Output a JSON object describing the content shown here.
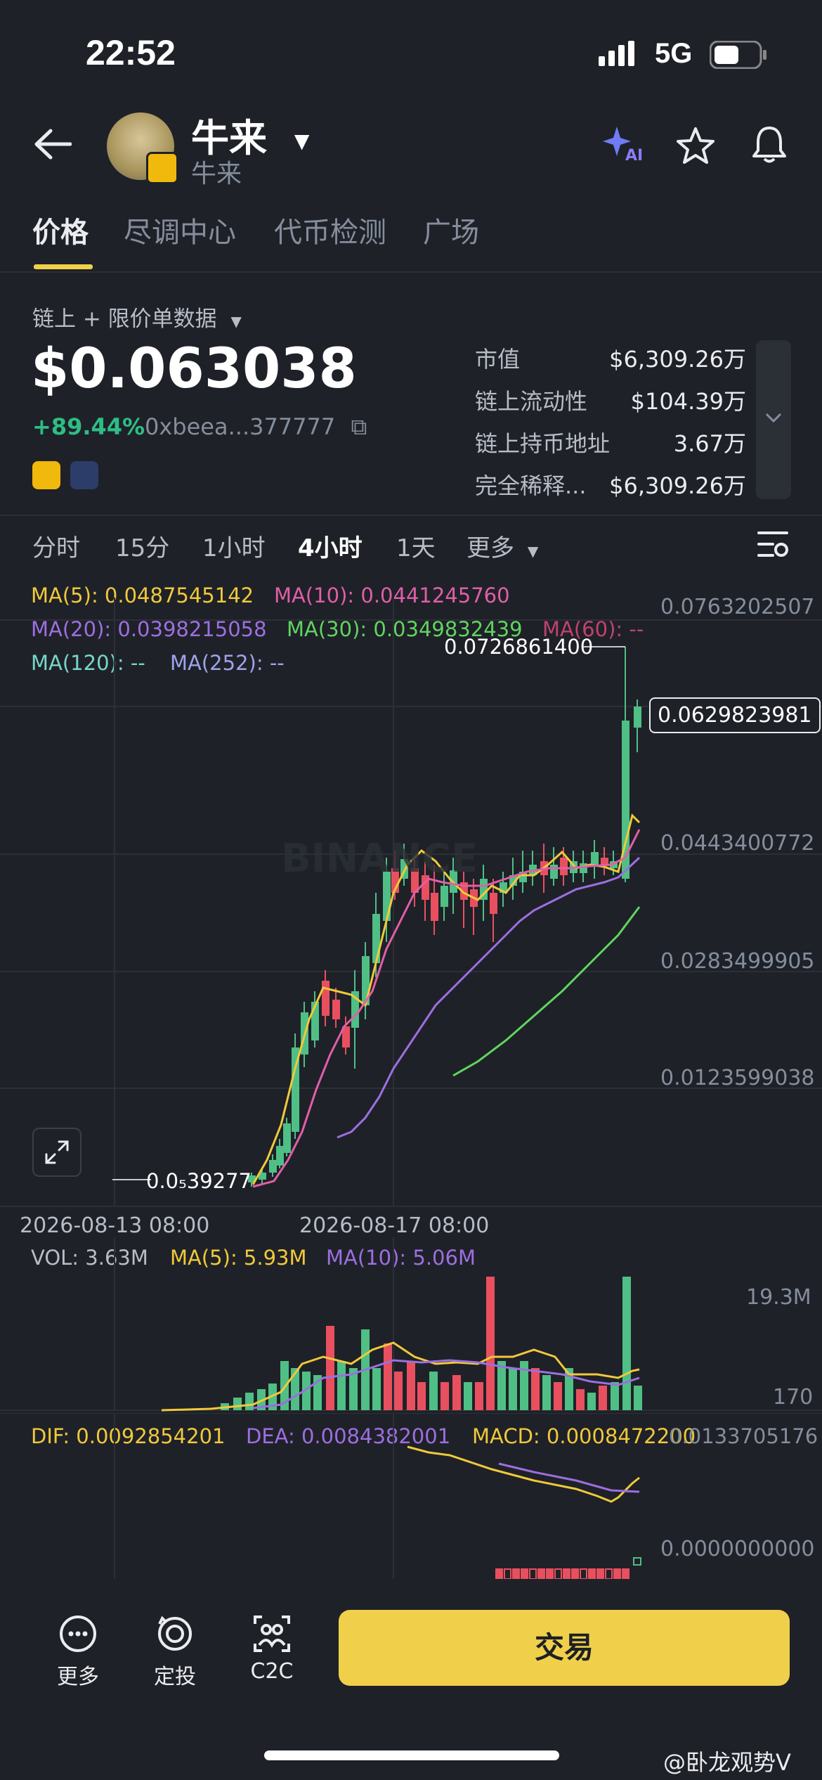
{
  "status_bar": {
    "time": "22:52",
    "network": "5G"
  },
  "header": {
    "title": "牛来",
    "subtitle": "牛来",
    "ai_badge": "AI"
  },
  "tabs": [
    "价格",
    "尽调中心",
    "代币检测",
    "广场"
  ],
  "data_source": "链上 + 限价单数据",
  "price": {
    "value": "$0.063038",
    "change": "+89.44%",
    "address": "0xbeea...377777"
  },
  "stats": [
    {
      "label": "市值",
      "value": "$6,309.26万"
    },
    {
      "label": "链上流动性",
      "value": "$104.39万"
    },
    {
      "label": "链上持币地址",
      "value": "3.67万"
    },
    {
      "label": "完全稀释...",
      "value": "$6,309.26万"
    }
  ],
  "timeframes": [
    "分时",
    "15分",
    "1小时",
    "4小时",
    "1天",
    "更多"
  ],
  "ma_lines": {
    "ma5": "MA(5): 0.0487545142",
    "ma10": "MA(10): 0.0441245760",
    "ma20": "MA(20): 0.0398215058",
    "ma30": "MA(30): 0.0349832439",
    "ma60": "MA(60): --",
    "ma120": "MA(120): --",
    "ma252": "MA(252): --"
  },
  "price_axis": [
    "0.0763202507",
    "0.0443400772",
    "0.0283499905",
    "0.0123599038"
  ],
  "current_price_tag": "0.0629823981",
  "high_label": "0.0726861400",
  "low_label": "0.0₅39277",
  "watermark": "BINANCE",
  "date_labels": [
    "2026-08-13 08:00",
    "2026-08-17 08:00"
  ],
  "volume": {
    "vol": "VOL: 3.63M",
    "ma5": "MA(5): 5.93M",
    "ma10": "MA(10): 5.06M",
    "axis_top": "19.3M",
    "axis_bottom": "170"
  },
  "macd": {
    "dif": "DIF: 0.0092854201",
    "dea": "DEA: 0.0084382001",
    "macd": "MACD: 0.0008472200",
    "axis_top": "0.0133705176",
    "axis_zero": "0.0000000000"
  },
  "bottom_nav": [
    {
      "label": "更多",
      "icon": "more-icon"
    },
    {
      "label": "定投",
      "icon": "auto-invest-icon"
    },
    {
      "label": "C2C",
      "icon": "c2c-icon"
    }
  ],
  "trade_button": "交易",
  "footer_watermark": "@卧龙观势V",
  "colors": {
    "accent": "#f0d04a",
    "up": "#4fbf85",
    "down": "#e8505f",
    "ma5": "#f0c93b",
    "ma10": "#e05fa8",
    "ma20": "#9c6fe0",
    "ma30": "#5fd55f",
    "ma120": "#76d6c9",
    "ma252": "#9da3e8"
  }
}
